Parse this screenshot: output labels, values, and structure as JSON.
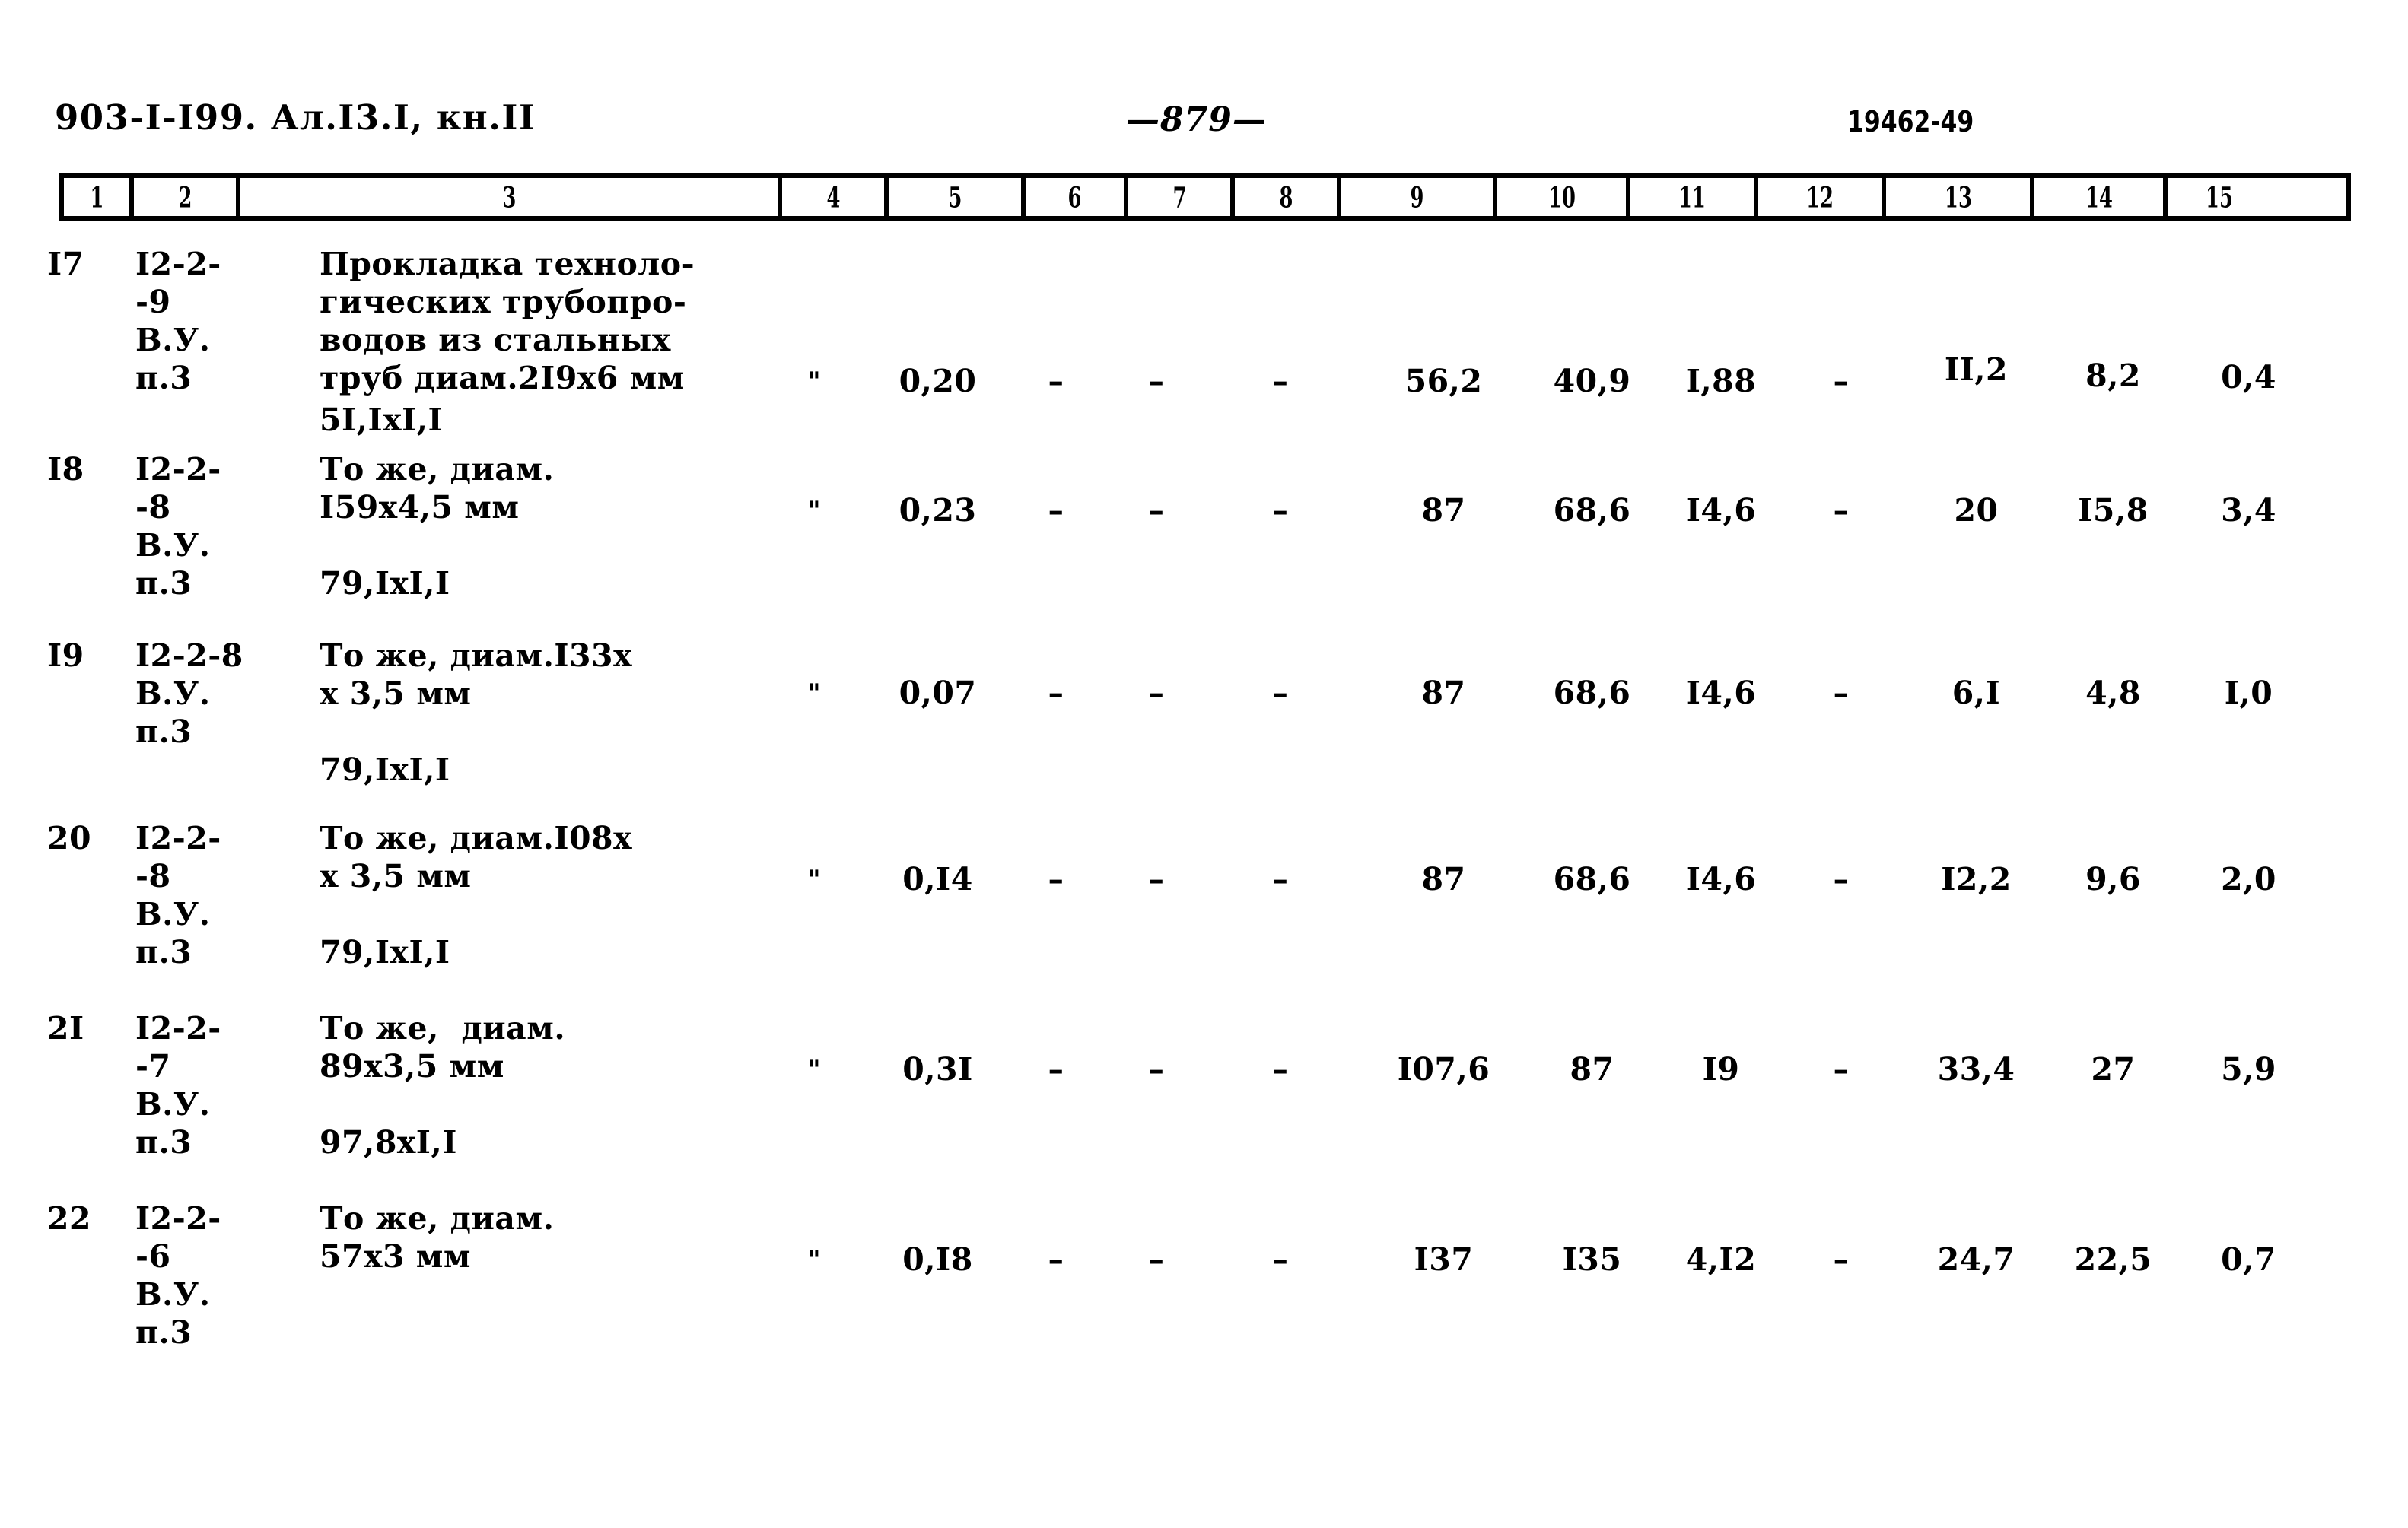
{
  "header": {
    "left": "903-I-I99. Ал.I3.I, кн.II",
    "page_number": "—879—",
    "stamp": "19462-49"
  },
  "table": {
    "column_numbers": [
      "1",
      "2",
      "3",
      "4",
      "5",
      "6",
      "7",
      "8",
      "9",
      "10",
      "11",
      "12",
      "13",
      "14",
      "15"
    ],
    "rows": [
      {
        "no": "I7",
        "code": "I2-2-\n-9\nВ.У.\nп.3",
        "desc": "Прокладка техноло-\nгических трубопро-\nводов из стальных\nтруб диам.2I9х6 мм",
        "desc_sub": "5I,IxI,I",
        "c4": "\"",
        "c5": "0,20",
        "c6": "–",
        "c7": "–",
        "c8": "–",
        "c9": "56,2",
        "c10": "40,9",
        "c11": "I,88",
        "c12": "–",
        "c13": "II,2",
        "c14": "8,2",
        "c15": "0,4"
      },
      {
        "no": "I8",
        "code": "I2-2-\n-8\nВ.У.\nп.3",
        "desc": "То же, диам.\nI59х4,5 мм",
        "desc_sub": "79,IxI,I",
        "c4": "\"",
        "c5": "0,23",
        "c6": "–",
        "c7": "–",
        "c8": "–",
        "c9": "87",
        "c10": "68,6",
        "c11": "I4,6",
        "c12": "–",
        "c13": "20",
        "c14": "I5,8",
        "c15": "3,4"
      },
      {
        "no": "I9",
        "code": "I2-2-8\nВ.У.\nп.3",
        "desc": "То же, диам.I33х\nх 3,5 мм",
        "desc_sub": "79,IxI,I",
        "c4": "\"",
        "c5": "0,07",
        "c6": "–",
        "c7": "–",
        "c8": "–",
        "c9": "87",
        "c10": "68,6",
        "c11": "I4,6",
        "c12": "–",
        "c13": "6,I",
        "c14": "4,8",
        "c15": "I,0"
      },
      {
        "no": "20",
        "code": "I2-2-\n-8\nВ.У.\nп.3",
        "desc": "То же, диам.I08х\nх 3,5 мм",
        "desc_sub": "79,IxI,I",
        "c4": "\"",
        "c5": "0,I4",
        "c6": "–",
        "c7": "–",
        "c8": "–",
        "c9": "87",
        "c10": "68,6",
        "c11": "I4,6",
        "c12": "–",
        "c13": "I2,2",
        "c14": "9,6",
        "c15": "2,0"
      },
      {
        "no": "2I",
        "code": "I2-2-\n-7\nВ.У.\nп.3",
        "desc": "То же,  диам.\n89х3,5 мм",
        "desc_sub": "97,8xI,I",
        "c4": "\"",
        "c5": "0,3I",
        "c6": "–",
        "c7": "–",
        "c8": "–",
        "c9": "I07,6",
        "c10": "87",
        "c11": "I9",
        "c12": "–",
        "c13": "33,4",
        "c14": "27",
        "c15": "5,9"
      },
      {
        "no": "22",
        "code": "I2-2-\n-6\nВ.У.\nп.3",
        "desc": "То же, диам.\n57х3 мм",
        "desc_sub": "",
        "c4": "\"",
        "c5": "0,I8",
        "c6": "–",
        "c7": "–",
        "c8": "–",
        "c9": "I37",
        "c10": "I35",
        "c11": "4,I2",
        "c12": "–",
        "c13": "24,7",
        "c14": "22,5",
        "c15": "0,7"
      }
    ]
  }
}
